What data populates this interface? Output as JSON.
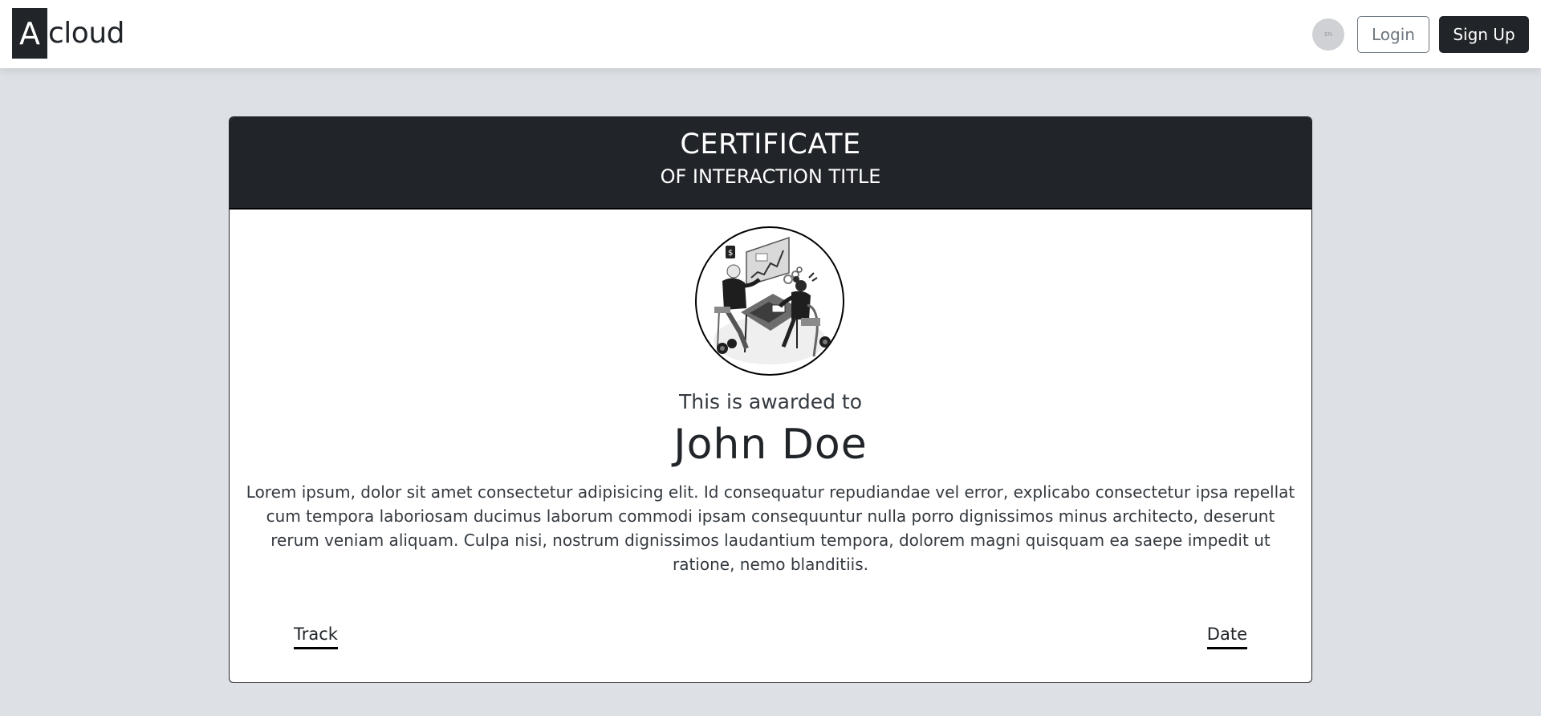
{
  "navbar": {
    "logo_letter": "A",
    "logo_text": "cloud",
    "lang_label": "EN",
    "login_label": "Login",
    "signup_label": "Sign Up"
  },
  "certificate": {
    "title": "CERTIFICATE",
    "subtitle": "OF INTERACTION TITLE",
    "awarded_text": "This is awarded to",
    "recipient_name": "John Doe",
    "description": "Lorem ipsum, dolor sit amet consectetur adipisicing elit. Id consequatur repudiandae vel error, explicabo consectetur ipsa repellat cum tempora laboriosam ducimus laborum commodi ipsam consequuntur nulla porro dignissimos minus architecto, deserunt rerum veniam aliquam. Culpa nisi, nostrum dignissimos laudantium tempora, dolorem magni quisquam ea saepe impedit ut ratione, nemo blanditiis.",
    "track_label": "Track",
    "date_label": "Date",
    "illustration_icon": "meeting-illustration"
  },
  "colors": {
    "page_bg": "#dde0e5",
    "dark": "#212529",
    "muted": "#6c757d"
  }
}
